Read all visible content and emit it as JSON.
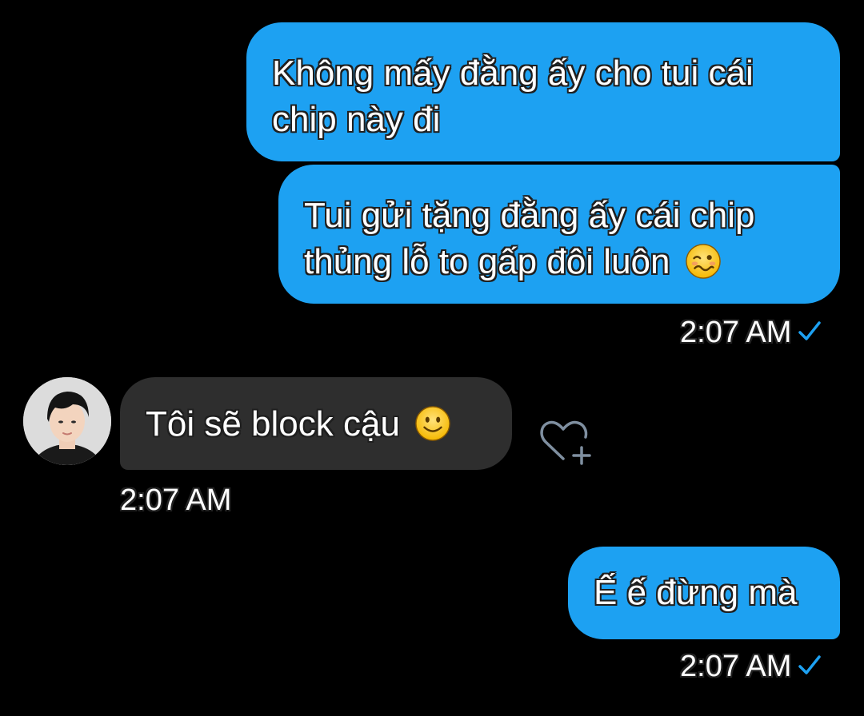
{
  "messages": [
    {
      "direction": "outgoing",
      "lines": [
        "Không mấy đằng ấy cho tui cái",
        "chip này đi"
      ]
    },
    {
      "direction": "outgoing",
      "lines": [
        "Tui gửi tặng đằng ấy cái chip",
        "thủng lỗ to gấp đôi luôn"
      ],
      "emoji": "woozy-face-emoji"
    },
    {
      "direction": "incoming",
      "text": "Tôi sẽ block cậu",
      "emoji": "slightly-smiling-face-emoji"
    },
    {
      "direction": "outgoing",
      "text": "Ế ế đừng mà"
    }
  ],
  "timestamps": {
    "first_group": "2:07 AM",
    "incoming": "2:07 AM",
    "last": "2:07 AM"
  },
  "icons": {
    "read_check": "checkmark-icon",
    "react": "heart-plus-icon"
  },
  "colors": {
    "background": "#000000",
    "outgoing_bubble": "#1da1f2",
    "incoming_bubble": "#2e2e2e",
    "check": "#1da1f2",
    "heart_icon": "#7f8fa0"
  }
}
